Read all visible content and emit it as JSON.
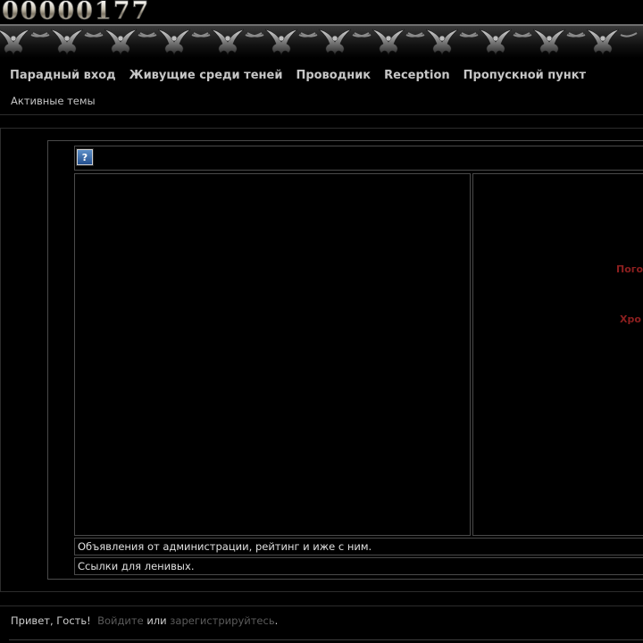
{
  "header": {
    "counter": "00000177"
  },
  "nav": {
    "items": [
      {
        "label": "Парадный вход"
      },
      {
        "label": "Живущие среди теней"
      },
      {
        "label": "Проводник"
      },
      {
        "label": "Reception"
      },
      {
        "label": "Пропускной пункт"
      }
    ]
  },
  "active_topics": "Активные темы",
  "toolbar": {
    "help_icon": "?"
  },
  "right_panel": {
    "links": [
      {
        "label": "Пого"
      },
      {
        "label": "Хро"
      }
    ]
  },
  "forums": [
    {
      "title": "Объявления от администрации, рейтинг и иже с ним."
    },
    {
      "title": "Ссылки для ленивых."
    }
  ],
  "footer": {
    "greeting": "Привет, Гость!",
    "login": "Войдите",
    "or": "или",
    "register": "зарегистрируйтесь",
    "period": "."
  },
  "colors": {
    "background": "#000000",
    "nav_text": "#c6c6c6",
    "red_link": "#8c1f1f",
    "dim_link": "#5b5b5b"
  }
}
